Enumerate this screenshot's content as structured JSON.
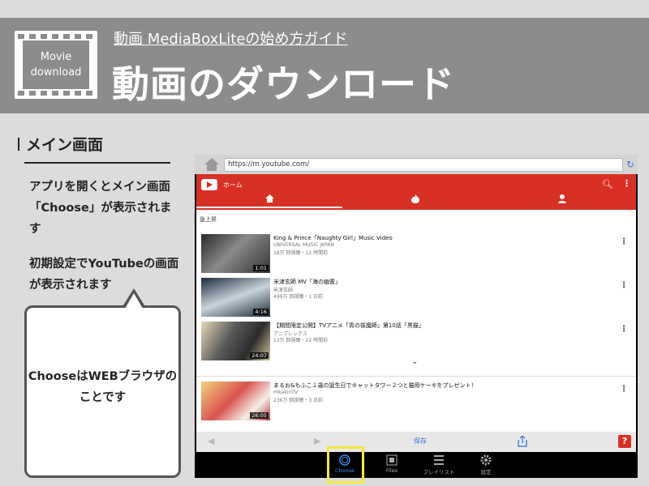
{
  "banner": {
    "logo_line1": "Movie",
    "logo_line2": "download",
    "subtitle": "動画 MediaBoxLiteの始め方ガイド",
    "title": "動画のダウンロード"
  },
  "section": {
    "title": "メイン画面",
    "para1": "アプリを開くとメイン画面「Choose」が表示されます",
    "para2": "初期設定でYouTubeの画面が表示されます",
    "bubble": "ChooseはWEBブラウザのことです"
  },
  "browser": {
    "url": "https://m.youtube.com/",
    "header_label": "ホーム",
    "trending_label": "急上昇",
    "videos": [
      {
        "title": "King & Prince「Naughty Girl」Music Video",
        "channel": "UNIVERSAL MUSIC JAPAN",
        "meta": "18万 回視聴・12 時間前",
        "duration": "1:01"
      },
      {
        "title": "米津玄師 MV「海の幽霊」",
        "channel": "米津玄師",
        "meta": "499万 回視聴・1 日前",
        "duration": "4:16"
      },
      {
        "title": "【期間限定公開】TVアニメ「青の祓魔師」第10話「黒猫」",
        "channel": "アニプレックス",
        "meta": "13万 回視聴・22 時間前",
        "duration": "24:07"
      },
      {
        "title": "まるお&もふこ１歳の誕生日でキャットタワー２つと猫用ケーキをプレゼント！",
        "channel": "HikakinTV",
        "meta": "236万 回視聴・3 日前",
        "duration": "26:05"
      }
    ],
    "save_label": "保存",
    "help_label": "?"
  },
  "tabbar": {
    "choose": "Choose",
    "files": "Files",
    "playlist": "プレイリスト",
    "settings": "設定"
  },
  "colors": {
    "banner": "#8c8c8c",
    "youtube_red": "#d93025",
    "highlight": "#f5ea3c"
  }
}
